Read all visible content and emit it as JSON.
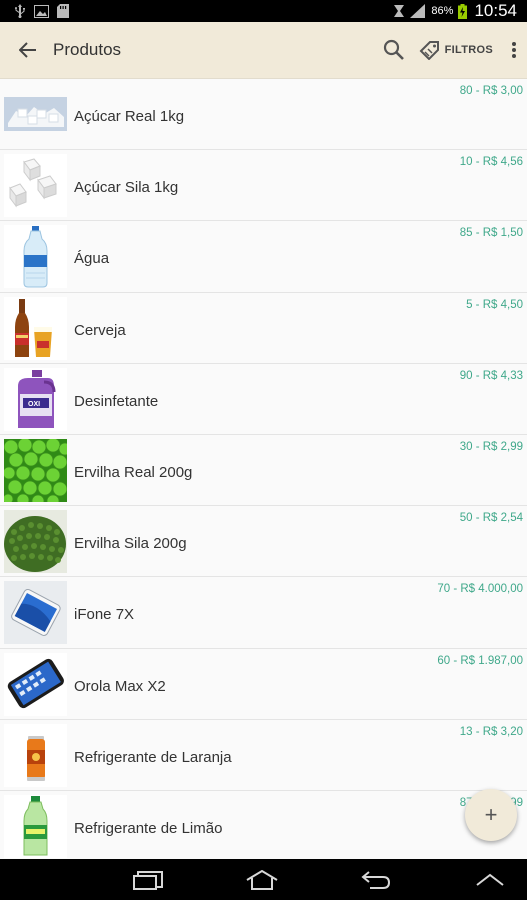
{
  "status_bar": {
    "battery_percent": "86%",
    "time": "10:54"
  },
  "appbar": {
    "title": "Produtos",
    "filter_label": "FILTROS"
  },
  "products": [
    {
      "name": "Açúcar Real 1kg",
      "qty_price": "80 - R$ 3,00",
      "image": "sugar-cubes-pile"
    },
    {
      "name": "Açúcar Sila 1kg",
      "qty_price": "10 - R$ 4,56",
      "image": "sugar-cubes"
    },
    {
      "name": "Água",
      "qty_price": "85 - R$ 1,50",
      "image": "water-bottle"
    },
    {
      "name": "Cerveja",
      "qty_price": "5 - R$ 4,50",
      "image": "beer-bottle-glass"
    },
    {
      "name": "Desinfetante",
      "qty_price": "90 - R$ 4,33",
      "image": "disinfectant-jug"
    },
    {
      "name": "Ervilha Real 200g",
      "qty_price": "30 - R$ 2,99",
      "image": "green-peas"
    },
    {
      "name": "Ervilha Sila 200g",
      "qty_price": "50 - R$ 2,54",
      "image": "peas-bowl"
    },
    {
      "name": "iFone 7X",
      "qty_price": "70 - R$ 4.000,00",
      "image": "white-smartphone"
    },
    {
      "name": "Orola Max X2",
      "qty_price": "60 - R$ 1.987,00",
      "image": "black-smartphone"
    },
    {
      "name": "Refrigerante de Laranja",
      "qty_price": "13 - R$ 3,20",
      "image": "orange-soda-can"
    },
    {
      "name": "Refrigerante de Limão",
      "qty_price": "87 - R$ 3,99",
      "image": "lemon-soda-bottle"
    }
  ],
  "fab": {
    "icon": "+"
  },
  "colors": {
    "appbar": "#f1ead9",
    "accent_text": "#3fa88a",
    "status_bar": "#000000"
  }
}
